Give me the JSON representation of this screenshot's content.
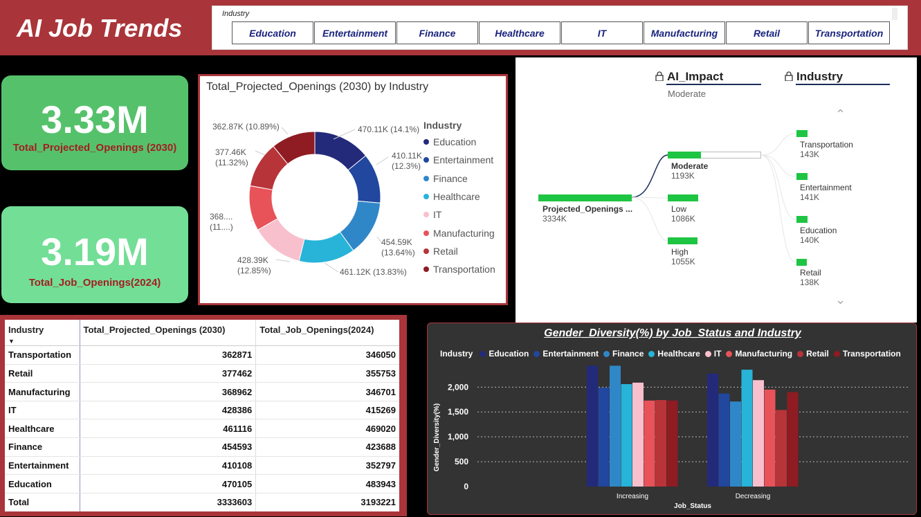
{
  "header": {
    "title": "AI Job Trends",
    "slicer_label": "Industry",
    "slicer_options": [
      "Education",
      "Entertainment",
      "Finance",
      "Healthcare",
      "IT",
      "Manufacturing",
      "Retail",
      "Transportation"
    ]
  },
  "kpis": [
    {
      "value": "3.33M",
      "label": "Total_Projected_Openings (2030)"
    },
    {
      "value": "3.19M",
      "label": "Total_Job_Openings(2024)"
    }
  ],
  "colors": {
    "Education": "#232a7a",
    "Entertainment": "#21479e",
    "Finance": "#3087c8",
    "Healthcare": "#28b4d8",
    "IT": "#f8c0cd",
    "Manufacturing": "#e85359",
    "Retail": "#b73439",
    "Transportation": "#8f1c22",
    "accent": "#a9353a",
    "node": "#1ec543"
  },
  "donut": {
    "title": "Total_Projected_Openings (2030) by Industry",
    "legend_title": "Industry",
    "labels": [
      {
        "line1": "470.11K (14.1%)",
        "line2": ""
      },
      {
        "line1": "410.11K",
        "line2": "(12.3%)"
      },
      {
        "line1": "454.59K",
        "line2": "(13.64%)"
      },
      {
        "line1": "461.12K (13.83%)",
        "line2": ""
      },
      {
        "line1": "428.39K",
        "line2": "(12.85%)"
      },
      {
        "line1": "368....",
        "line2": "(11....)"
      },
      {
        "line1": "377.46K",
        "line2": "(11.32%)"
      },
      {
        "line1": "362.87K (10.89%)",
        "line2": ""
      }
    ]
  },
  "decomp": {
    "level1_title": "AI_Impact",
    "level1_selected": "Moderate",
    "level2_title": "Industry",
    "root": {
      "name": "Projected_Openings ...",
      "value": "3334K"
    },
    "impact": [
      {
        "name": "Moderate",
        "value": "1193K"
      },
      {
        "name": "Low",
        "value": "1086K"
      },
      {
        "name": "High",
        "value": "1055K"
      }
    ],
    "industries": [
      {
        "name": "Transportation",
        "value": "143K"
      },
      {
        "name": "Entertainment",
        "value": "141K"
      },
      {
        "name": "Education",
        "value": "140K"
      },
      {
        "name": "Retail",
        "value": "138K"
      }
    ]
  },
  "table": {
    "headers": [
      "Industry",
      "Total_Projected_Openings (2030)",
      "Total_Job_Openings(2024)"
    ],
    "rows": [
      [
        "Transportation",
        "362871",
        "346050"
      ],
      [
        "Retail",
        "377462",
        "355753"
      ],
      [
        "Manufacturing",
        "368962",
        "346701"
      ],
      [
        "IT",
        "428386",
        "415269"
      ],
      [
        "Healthcare",
        "461116",
        "469020"
      ],
      [
        "Finance",
        "454593",
        "423688"
      ],
      [
        "Entertainment",
        "410108",
        "352797"
      ],
      [
        "Education",
        "470105",
        "483943"
      ]
    ],
    "total": [
      "Total",
      "3333603",
      "3193221"
    ]
  },
  "chart_data": [
    {
      "type": "pie",
      "title": "Total_Projected_Openings (2030) by Industry",
      "categories": [
        "Education",
        "Entertainment",
        "Finance",
        "Healthcare",
        "IT",
        "Manufacturing",
        "Retail",
        "Transportation"
      ],
      "values": [
        470105,
        410108,
        454593,
        461116,
        428386,
        368962,
        377462,
        362871
      ],
      "legend": "right",
      "donut": true
    },
    {
      "type": "bar",
      "title": "Gender_Diversity(%) by Job_Status and Industry",
      "xlabel": "Job_Status",
      "ylabel": "Gender_Diversity(%)",
      "legend_title": "Industry",
      "categories": [
        "Increasing",
        "Decreasing"
      ],
      "series": [
        {
          "name": "Education",
          "values": [
            2430,
            2270
          ]
        },
        {
          "name": "Entertainment",
          "values": [
            1990,
            1870
          ]
        },
        {
          "name": "Finance",
          "values": [
            2430,
            1710
          ]
        },
        {
          "name": "Healthcare",
          "values": [
            2060,
            2350
          ]
        },
        {
          "name": "IT",
          "values": [
            2090,
            2140
          ]
        },
        {
          "name": "Manufacturing",
          "values": [
            1730,
            1950
          ]
        },
        {
          "name": "Retail",
          "values": [
            1740,
            1540
          ]
        },
        {
          "name": "Transportation",
          "values": [
            1730,
            1900
          ]
        }
      ],
      "yticks": [
        "0",
        "500",
        "1,000",
        "1,500",
        "2,000"
      ],
      "ylim": [
        0,
        2450
      ],
      "grid": true,
      "legend": "top"
    }
  ]
}
